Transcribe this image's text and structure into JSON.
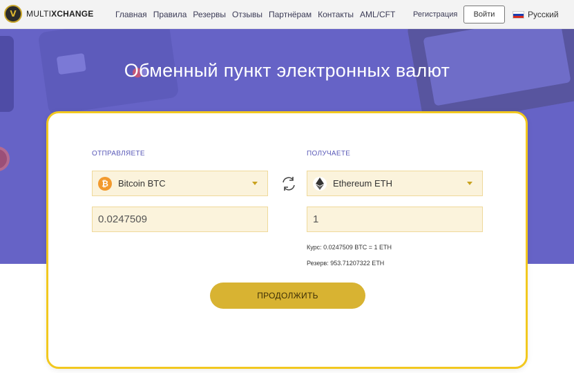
{
  "header": {
    "logo": {
      "prefix": "MULTI",
      "suffix": "XCHANGE",
      "mark": "V"
    },
    "nav": [
      "Главная",
      "Правила",
      "Резервы",
      "Отзывы",
      "Партнёрам",
      "Контакты",
      "AML/CFT"
    ],
    "register_label": "Регистрация",
    "login_label": "Войти",
    "language_label": "Русский",
    "flag_colors": [
      "#ffffff",
      "#1c3fb0",
      "#d52b1e"
    ]
  },
  "hero": {
    "title": "Обменный пункт электронных валют",
    "background_color": "#6663c6"
  },
  "exchange": {
    "send": {
      "label": "ОТПРАВЛЯЕТЕ",
      "currency": "Bitcoin BTC",
      "icon": "bitcoin-icon",
      "amount": "0.0247509"
    },
    "receive": {
      "label": "ПОЛУЧАЕТЕ",
      "currency": "Ethereum ETH",
      "icon": "ethereum-icon",
      "amount": "1"
    },
    "rate": {
      "label": "Курс:",
      "value": "0.0247509 BTC = 1 ETH"
    },
    "reserve": {
      "label": "Резерв:",
      "value": "953.71207322 ETH"
    },
    "continue_label": "ПРОДОЛЖИТЬ",
    "accent_color": "#f2c81f"
  }
}
